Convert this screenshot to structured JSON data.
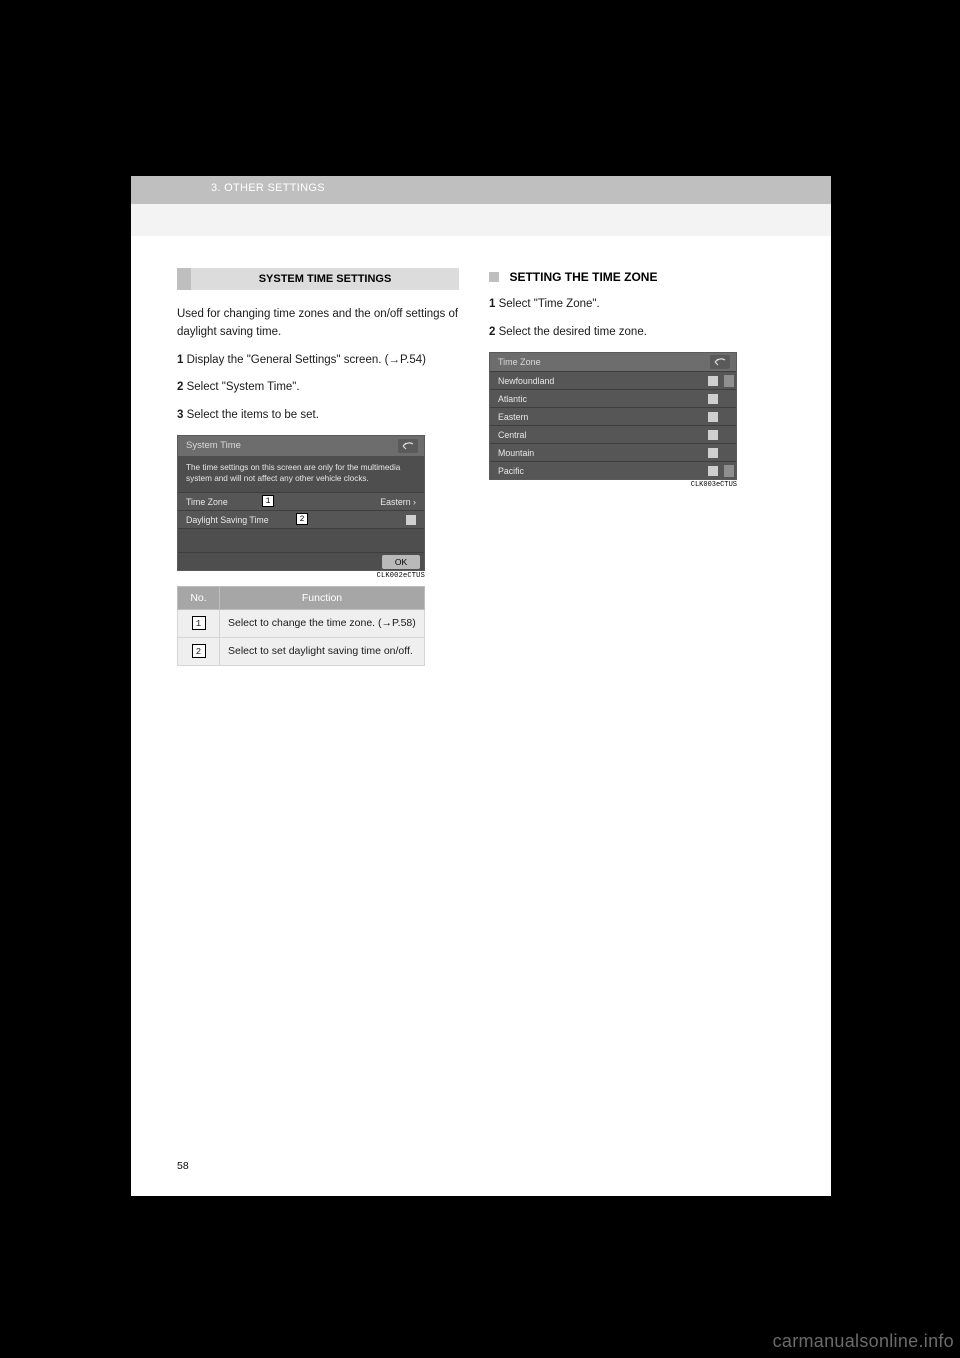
{
  "breadcrumb": "3. OTHER SETTINGS",
  "heading": "SYSTEM TIME SETTINGS",
  "intro": {
    "p1": "Used for changing time zones and the on/off settings of daylight saving time.",
    "step1_num": "1",
    "step1": "Display the \"General Settings\" screen. (→P.54)",
    "step2_num": "2",
    "step2": "Select \"System Time\".",
    "step3_num": "3",
    "step3": "Select the items to be set."
  },
  "system_time_shot": {
    "title": "System Time",
    "note": "The time settings on this screen are only for the multimedia system and will not affect any other vehicle clocks.",
    "row1_label": "Time Zone",
    "row1_value": "Eastern ›",
    "row1_callout": "1",
    "row2_label": "Daylight Saving Time",
    "row2_callout": "2",
    "ok": "OK",
    "caption": "CLK002eCTUS"
  },
  "func_table": {
    "col_no": "No.",
    "col_fn": "Function",
    "rows": [
      {
        "no": "1",
        "fn": "Select to change the time zone. (→P.58)"
      },
      {
        "no": "2",
        "fn": "Select to set daylight saving time on/off."
      }
    ]
  },
  "right": {
    "sub": "SETTING THE TIME ZONE",
    "step1_num": "1",
    "step1": "Select \"Time Zone\".",
    "step2_num": "2",
    "step2": "Select the desired time zone."
  },
  "tz_shot": {
    "title": "Time Zone",
    "options": [
      "Newfoundland",
      "Atlantic",
      "Eastern",
      "Central",
      "Mountain",
      "Pacific"
    ],
    "caption": "CLK003eCTUS"
  },
  "page_number": "58",
  "watermark": "carmanualsonline.info"
}
